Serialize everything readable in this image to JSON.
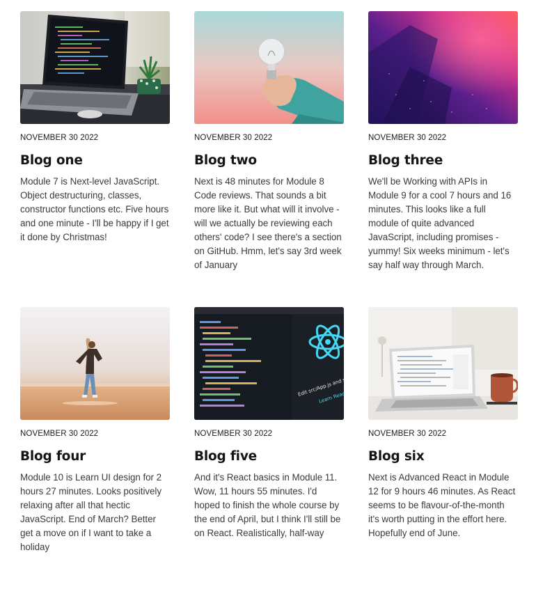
{
  "posts": [
    {
      "image": "laptop-code-desk-image",
      "date": "NOVEMBER 30 2022",
      "title": "Blog one",
      "body": "Module 7 is Next-level JavaScript. Object destructuring, classes, constructor functions etc. Five hours and one minute - I'll be happy if I get it done by Christmas!"
    },
    {
      "image": "hand-holding-lightbulb-image",
      "date": "NOVEMBER 30 2022",
      "title": "Blog two",
      "body": "Next is 48 minutes for Module 8 Code reviews. That sounds a bit more like it. But what will it involve - will we actually be reviewing each others' code? I see there's a section on GitHub. Hmm, let's say 3rd week of January"
    },
    {
      "image": "purple-abstract-image",
      "date": "NOVEMBER 30 2022",
      "title": "Blog three",
      "body": "We'll be Working with APIs in Module 9 for a cool 7 hours and 16 minutes. This looks like a full module of quite advanced JavaScript, including promises - yummy! Six weeks minimum - let's say half way through March."
    },
    {
      "image": "woman-on-beach-image",
      "date": "NOVEMBER 30 2022",
      "title": "Blog four",
      "body": "Module 10 is Learn UI design for 2 hours 27 minutes. Looks positively relaxing after all that hectic JavaScript. End of March? Better get a move on if I want to take a holiday"
    },
    {
      "image": "react-code-screen-image",
      "date": "NOVEMBER 30 2022",
      "title": "Blog five",
      "body": "And it's React basics in Module 11. Wow, 11 hours 55 minutes. I'd hoped to finish the whole course by the end of April, but I think I'll still be on React. Realistically, half-way"
    },
    {
      "image": "laptop-coffee-mug-image",
      "date": "NOVEMBER 30 2022",
      "title": "Blog six",
      "body": "Next is Advanced React in Module 12 for 9 hours 46 minutes. As React seems to be flavour-of-the-month it's worth putting in the effort here. Hopefully end of June."
    }
  ],
  "thumb_text": {
    "react_line": "Edit src/App.js and save",
    "react_link": "Learn React"
  }
}
